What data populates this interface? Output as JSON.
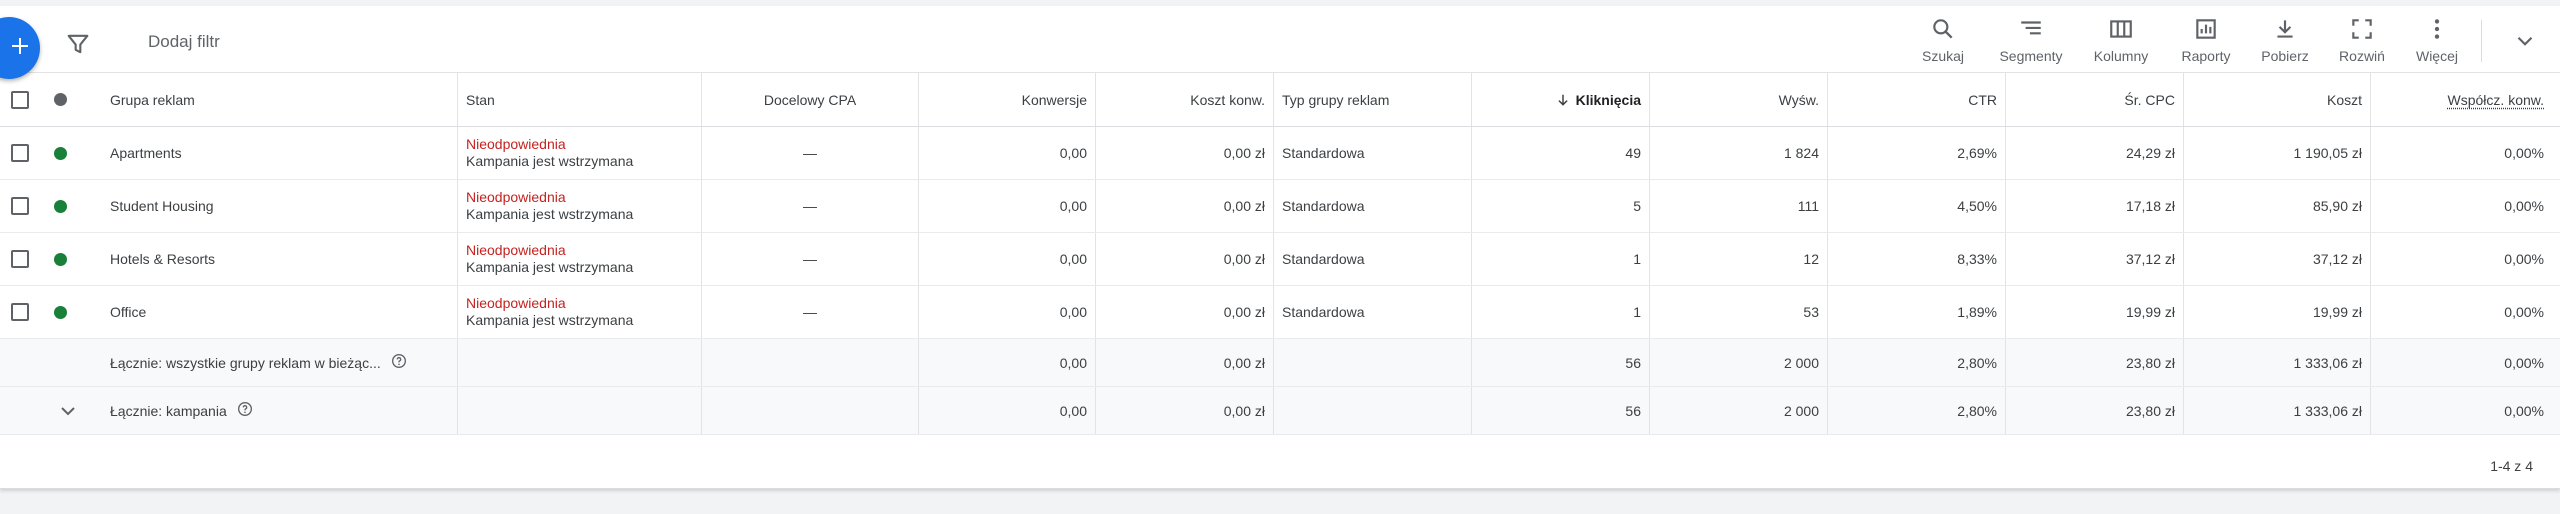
{
  "toolbar": {
    "filter_placeholder": "Dodaj filtr",
    "buttons": [
      {
        "label": "Szukaj",
        "icon": "search-icon"
      },
      {
        "label": "Segmenty",
        "icon": "segments-icon"
      },
      {
        "label": "Kolumny",
        "icon": "columns-icon"
      },
      {
        "label": "Raporty",
        "icon": "reports-icon"
      },
      {
        "label": "Pobierz",
        "icon": "download-icon"
      },
      {
        "label": "Rozwiń",
        "icon": "expand-icon"
      },
      {
        "label": "Więcej",
        "icon": "more-icon"
      }
    ]
  },
  "table": {
    "headers": {
      "name": "Grupa reklam",
      "stan": "Stan",
      "cpa": "Docelowy CPA",
      "konw": "Konwersje",
      "koszt_konw": "Koszt konw.",
      "typ": "Typ grupy reklam",
      "klik": "Kliknięcia",
      "wysw": "Wyśw.",
      "ctr": "CTR",
      "cpc": "Śr. CPC",
      "koszt": "Koszt",
      "wsp": "Współcz. konw."
    },
    "rows": [
      {
        "name": "Apartments",
        "stan": "Nieodpowiednia",
        "stan_sub": "Kampania jest wstrzymana",
        "cpa": "—",
        "konw": "0,00",
        "koszt_konw": "0,00 zł",
        "typ": "Standardowa",
        "klik": "49",
        "wysw": "1 824",
        "ctr": "2,69%",
        "cpc": "24,29 zł",
        "koszt": "1 190,05 zł",
        "wsp": "0,00%"
      },
      {
        "name": "Student Housing",
        "stan": "Nieodpowiednia",
        "stan_sub": "Kampania jest wstrzymana",
        "cpa": "—",
        "konw": "0,00",
        "koszt_konw": "0,00 zł",
        "typ": "Standardowa",
        "klik": "5",
        "wysw": "111",
        "ctr": "4,50%",
        "cpc": "17,18 zł",
        "koszt": "85,90 zł",
        "wsp": "0,00%"
      },
      {
        "name": "Hotels & Resorts",
        "stan": "Nieodpowiednia",
        "stan_sub": "Kampania jest wstrzymana",
        "cpa": "—",
        "konw": "0,00",
        "koszt_konw": "0,00 zł",
        "typ": "Standardowa",
        "klik": "1",
        "wysw": "12",
        "ctr": "8,33%",
        "cpc": "37,12 zł",
        "koszt": "37,12 zł",
        "wsp": "0,00%"
      },
      {
        "name": "Office",
        "stan": "Nieodpowiednia",
        "stan_sub": "Kampania jest wstrzymana",
        "cpa": "—",
        "konw": "0,00",
        "koszt_konw": "0,00 zł",
        "typ": "Standardowa",
        "klik": "1",
        "wysw": "53",
        "ctr": "1,89%",
        "cpc": "19,99 zł",
        "koszt": "19,99 zł",
        "wsp": "0,00%"
      }
    ],
    "totals": [
      {
        "label": "Łącznie: wszystkie grupy reklam w bieżąc...",
        "konw": "0,00",
        "koszt_konw": "0,00 zł",
        "klik": "56",
        "wysw": "2 000",
        "ctr": "2,80%",
        "cpc": "23,80 zł",
        "koszt": "1 333,06 zł",
        "wsp": "0,00%"
      },
      {
        "label": "Łącznie: kampania",
        "konw": "0,00",
        "koszt_konw": "0,00 zł",
        "klik": "56",
        "wysw": "2 000",
        "ctr": "2,80%",
        "cpc": "23,80 zł",
        "koszt": "1 333,06 zł",
        "wsp": "0,00%"
      }
    ]
  },
  "pagination": "1-4 z 4",
  "colors": {
    "accent": "#1a73e8",
    "status_red": "#c5221f",
    "enabled_green": "#188038"
  }
}
